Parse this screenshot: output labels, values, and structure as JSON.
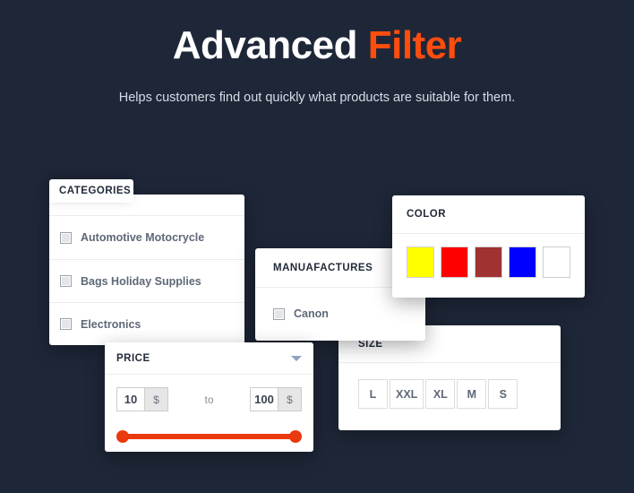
{
  "hero": {
    "title_main": "Advanced ",
    "title_accent": "Filter",
    "subtitle": "Helps customers find out quickly what products are suitable for them.",
    "accent_color": "#ff4d0d",
    "background_color": "#1e2738"
  },
  "panels": {
    "categories": {
      "title": "CATEGORIES",
      "items": [
        {
          "label": "Automotive Motocrycle",
          "checked": false
        },
        {
          "label": "Bags Holiday Supplies",
          "checked": false
        },
        {
          "label": "Electronics",
          "checked": false
        }
      ]
    },
    "manufactures": {
      "title": "MANUAFACTURES",
      "items": [
        {
          "label": "Canon",
          "checked": false
        }
      ]
    },
    "color": {
      "title": "COLOR",
      "swatches": [
        {
          "name": "yellow",
          "hex": "#ffff00"
        },
        {
          "name": "red",
          "hex": "#ff0000"
        },
        {
          "name": "brown",
          "hex": "#a03232"
        },
        {
          "name": "blue",
          "hex": "#0000ff"
        },
        {
          "name": "white",
          "hex": "#ffffff"
        }
      ]
    },
    "price": {
      "title": "PRICE",
      "min_value": "10",
      "max_value": "100",
      "currency": "$",
      "separator": "to",
      "slider_color": "#ea390f",
      "collapse_icon": "chevron-down-icon"
    },
    "size": {
      "title": "SIZE",
      "options": [
        "L",
        "XXL",
        "XL",
        "M",
        "S"
      ]
    }
  }
}
